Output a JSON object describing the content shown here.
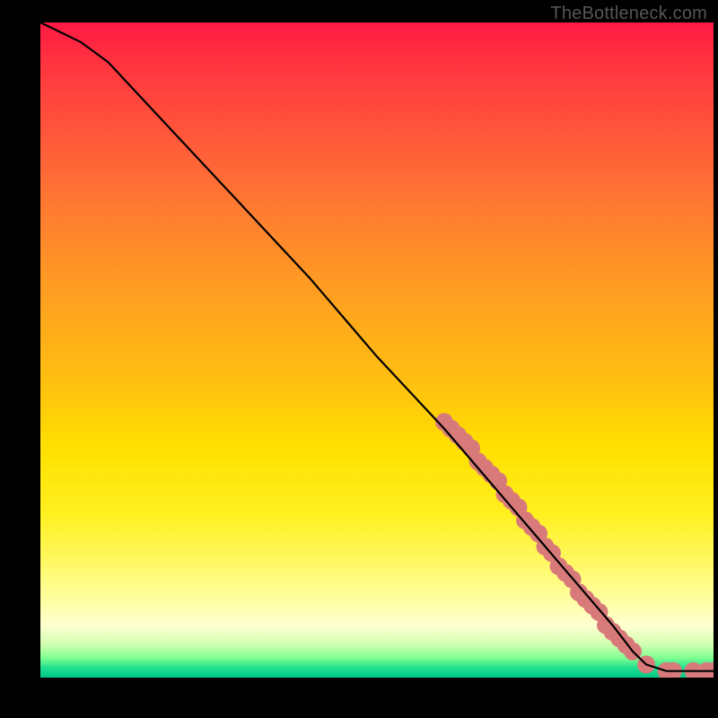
{
  "watermark": "TheBottleneck.com",
  "chart_data": {
    "type": "line",
    "title": "",
    "xlabel": "",
    "ylabel": "",
    "xlim": [
      0,
      100
    ],
    "ylim": [
      0,
      100
    ],
    "grid": false,
    "line": {
      "x": [
        0,
        2,
        6,
        10,
        20,
        30,
        40,
        50,
        60,
        65,
        70,
        75,
        80,
        85,
        88,
        90,
        93,
        96,
        100
      ],
      "y": [
        100,
        99,
        97,
        94,
        83,
        72,
        61,
        49,
        38,
        32,
        26,
        20,
        14,
        8,
        4,
        2,
        1,
        1,
        1
      ]
    },
    "marker_points": {
      "x": [
        60,
        61,
        62,
        63,
        64,
        65,
        66,
        67,
        68,
        69,
        70,
        71,
        72,
        73,
        74,
        75,
        76,
        77,
        78,
        79,
        80,
        81,
        82,
        83,
        84,
        85,
        86,
        87,
        88,
        90,
        93,
        94,
        97,
        99,
        100
      ],
      "y": [
        39,
        38,
        37,
        36,
        35,
        33,
        32,
        31,
        30,
        28,
        27,
        26,
        24,
        23,
        22,
        20,
        19,
        17,
        16,
        15,
        13,
        12,
        11,
        10,
        8,
        7,
        6,
        5,
        4,
        2,
        1,
        1,
        1,
        1,
        1
      ],
      "color": "#d97a7a",
      "radius": 10
    },
    "colors": {
      "line": "#000000",
      "gradient_top": "#ff1a44",
      "gradient_bottom": "#00c888"
    }
  }
}
